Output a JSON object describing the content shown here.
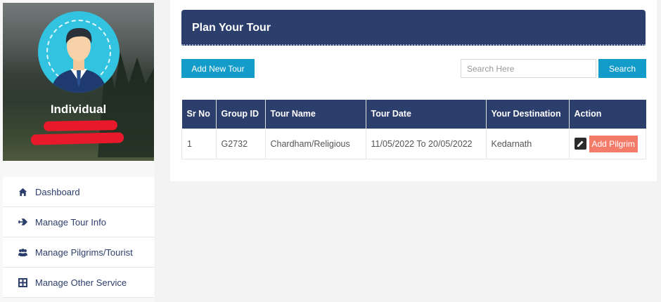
{
  "profile": {
    "name": "Individual"
  },
  "sidebar": {
    "items": [
      {
        "label": "Dashboard",
        "icon": "home-icon"
      },
      {
        "label": "Manage Tour Info",
        "icon": "airplane-icon"
      },
      {
        "label": "Manage Pilgrims/Tourist",
        "icon": "users-icon"
      },
      {
        "label": "Manage Other Service",
        "icon": "grid-icon"
      }
    ]
  },
  "main": {
    "title": "Plan Your Tour",
    "add_button": "Add New Tour",
    "search": {
      "placeholder": "Search Here",
      "button": "Search"
    },
    "table": {
      "headers": [
        "Sr No",
        "Group ID",
        "Tour Name",
        "Tour Date",
        "Your Destination",
        "Action"
      ],
      "rows": [
        {
          "sr_no": "1",
          "group_id": "G2732",
          "tour_name": "Chardham/Religious",
          "tour_date": "11/05/2022 To 20/05/2022",
          "destination": "Kedarnath",
          "action_label": "Add Pilgrim"
        }
      ]
    }
  },
  "colors": {
    "navy": "#2c3e6b",
    "button_blue": "#139cc9",
    "add_pilgrim": "#f27b6a",
    "avatar_bg": "#31c3e0"
  }
}
